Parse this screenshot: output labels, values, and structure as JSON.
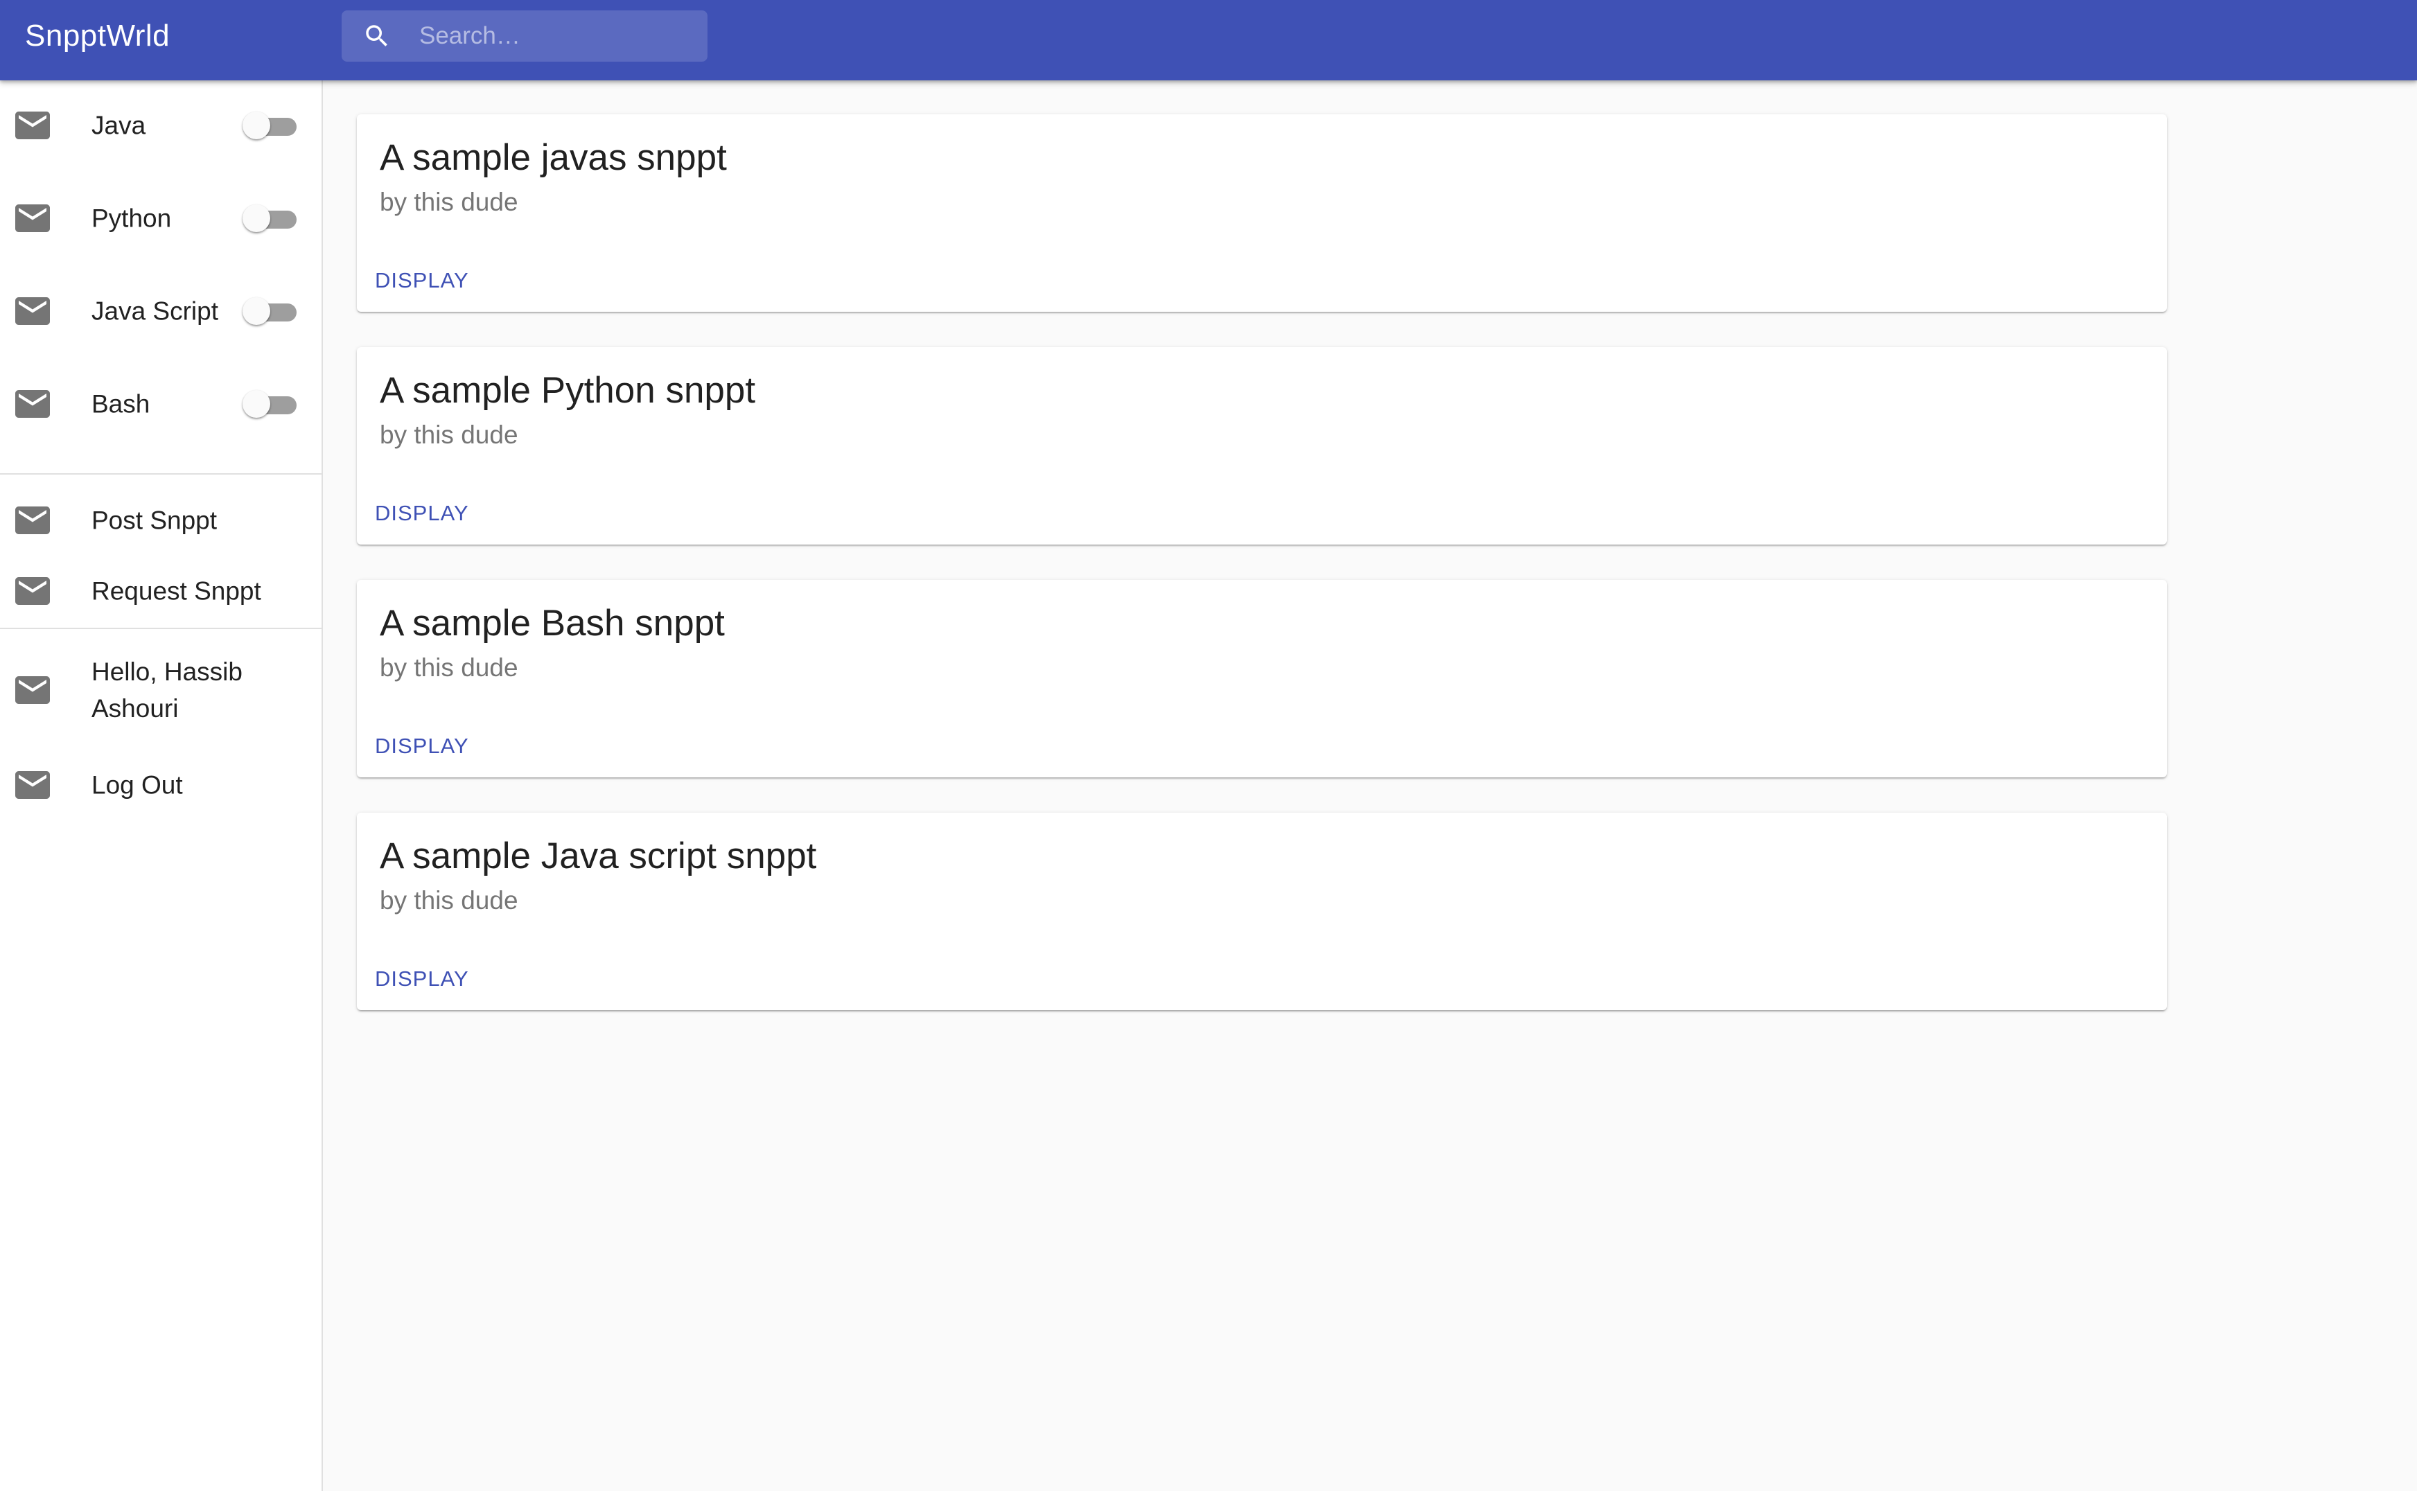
{
  "appbar": {
    "title": "SnpptWrld",
    "color": "#3f51b5",
    "search": {
      "placeholder": "Search…",
      "value": "",
      "icon": "search-icon"
    }
  },
  "drawer": {
    "languages": [
      {
        "label": "Java",
        "icon": "mail-icon",
        "enabled": false
      },
      {
        "label": "Python",
        "icon": "mail-icon",
        "enabled": false
      },
      {
        "label": "Java Script",
        "icon": "mail-icon",
        "enabled": false
      },
      {
        "label": "Bash",
        "icon": "mail-icon",
        "enabled": false
      }
    ],
    "actions": [
      {
        "label": "Post Snppt",
        "icon": "mail-icon"
      },
      {
        "label": "Request Snppt",
        "icon": "mail-icon"
      }
    ],
    "account": [
      {
        "label": "Hello, Hassib Ashouri",
        "icon": "mail-icon"
      },
      {
        "label": "Log Out",
        "icon": "mail-icon"
      }
    ]
  },
  "cards": [
    {
      "title": "A sample javas snppt",
      "subtitle": "by this dude",
      "action": "Display"
    },
    {
      "title": "A sample Python snppt",
      "subtitle": "by this dude",
      "action": "Display"
    },
    {
      "title": "A sample Bash snppt",
      "subtitle": "by this dude",
      "action": "Display"
    },
    {
      "title": "A sample Java script snppt",
      "subtitle": "by this dude",
      "action": "Display"
    }
  ]
}
